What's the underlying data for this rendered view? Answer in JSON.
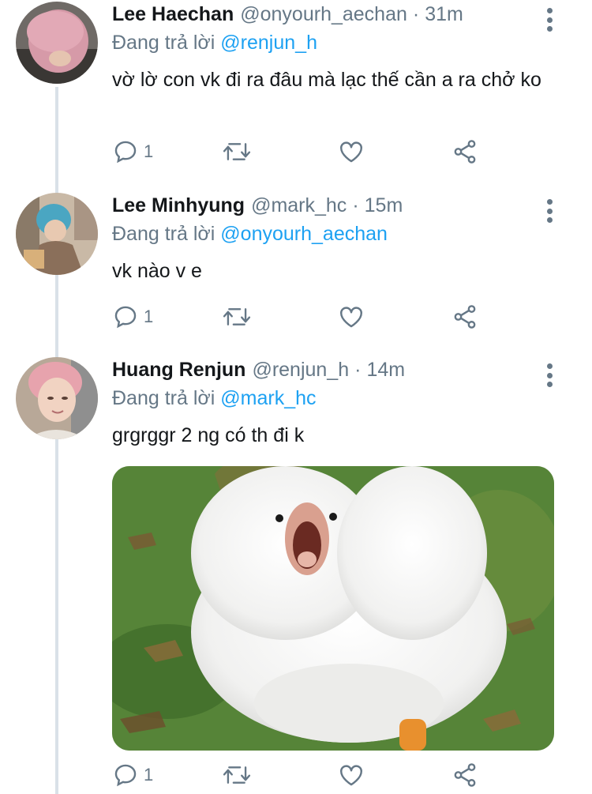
{
  "tweets": [
    {
      "name": "Lee Haechan",
      "handle": "@onyourh_aechan",
      "separator": "·",
      "time": "31m",
      "reply_prefix": "Đang trả lời",
      "reply_to": "@renjun_h",
      "text": "vờ lờ con vk đi ra đâu mà lạc thế cần a ra chở ko",
      "reply_count": "1"
    },
    {
      "name": "Lee Minhyung",
      "handle": "@mark_hc",
      "separator": "·",
      "time": "15m",
      "reply_prefix": "Đang trả lời",
      "reply_to": "@onyourh_aechan",
      "text": "vk nào v e",
      "reply_count": "1"
    },
    {
      "name": "Huang Renjun",
      "handle": "@renjun_h",
      "separator": "·",
      "time": "14m",
      "reply_prefix": "Đang trả lời",
      "reply_to": "@mark_hc",
      "text": "grgrggr 2 ng có th đi k",
      "reply_count": "1",
      "media": "goose-photo"
    }
  ],
  "icons": {
    "reply": "reply-icon",
    "retweet": "retweet-icon",
    "like": "like-icon",
    "share": "share-icon",
    "more": "more-options-icon"
  },
  "colors": {
    "accent": "#1da1f2",
    "secondary_text": "#657786",
    "thread_line": "#d9e1e8"
  }
}
